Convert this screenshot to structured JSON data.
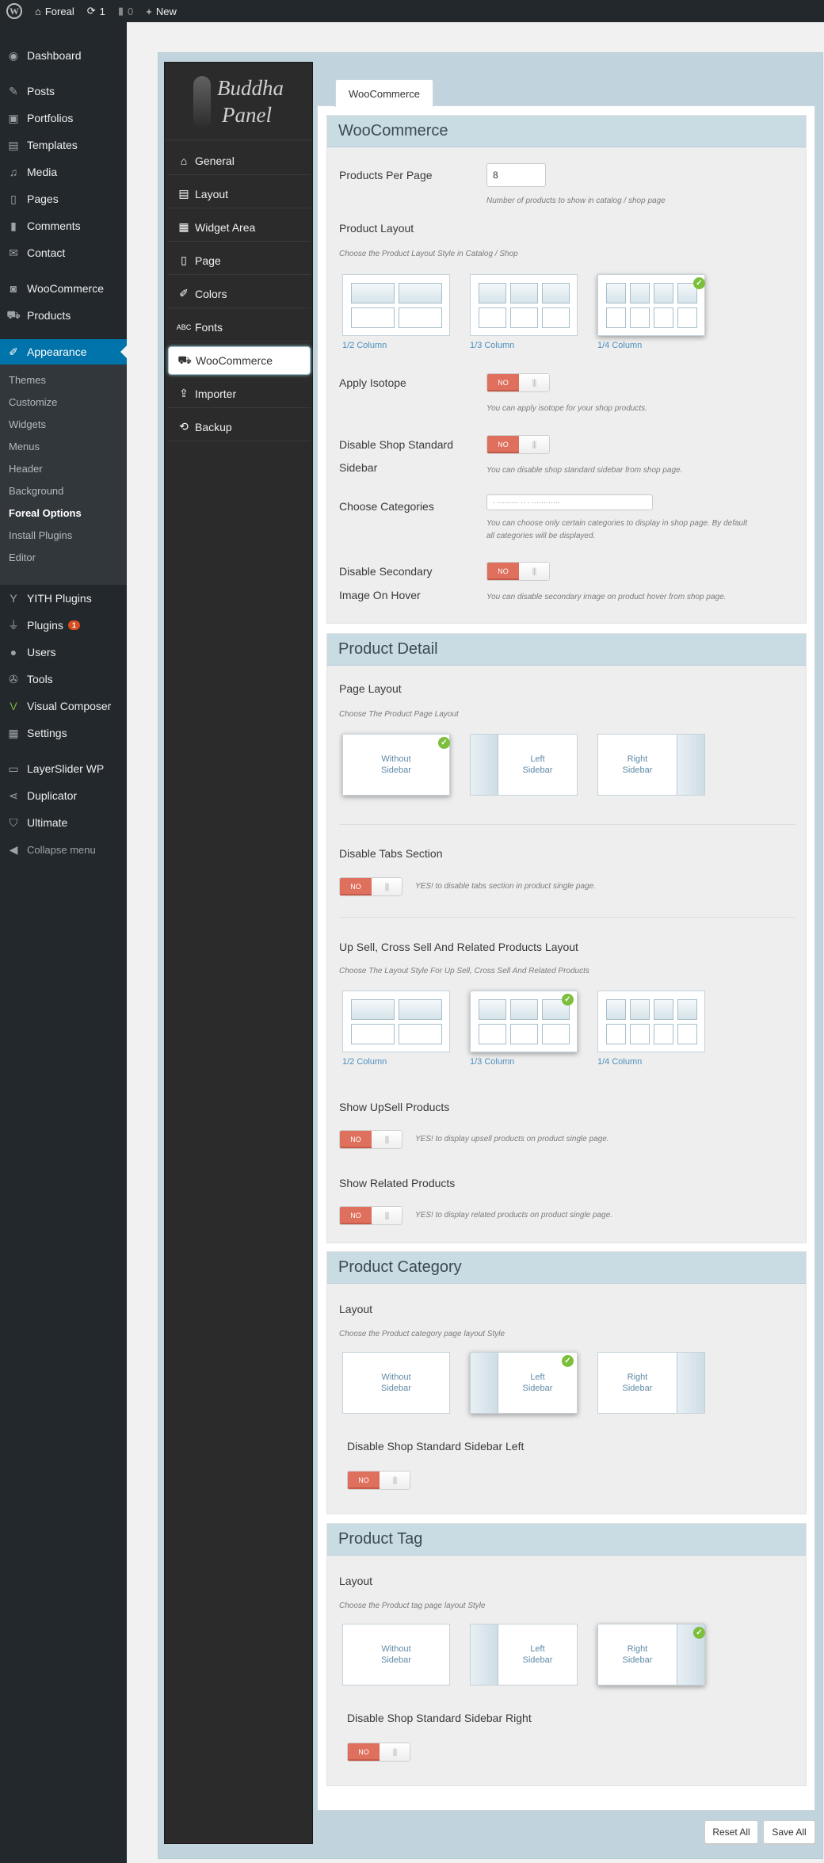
{
  "adminbar": {
    "site": "Foreal",
    "updates": "1",
    "comments": "0",
    "new": "New"
  },
  "menu": {
    "dashboard": "Dashboard",
    "posts": "Posts",
    "portfolios": "Portfolios",
    "templates": "Templates",
    "media": "Media",
    "pages": "Pages",
    "comments": "Comments",
    "contact": "Contact",
    "woocommerce": "WooCommerce",
    "products": "Products",
    "appearance": "Appearance",
    "sub": [
      "Themes",
      "Customize",
      "Widgets",
      "Menus",
      "Header",
      "Background",
      "Foreal Options",
      "Install Plugins",
      "Editor"
    ],
    "yith": "YITH Plugins",
    "plugins": "Plugins",
    "plugins_badge": "1",
    "users": "Users",
    "tools": "Tools",
    "vc": "Visual Composer",
    "settings": "Settings",
    "layerslider": "LayerSlider WP",
    "duplicator": "Duplicator",
    "ultimate": "Ultimate",
    "collapse": "Collapse menu"
  },
  "panel": {
    "logo_line1": "Buddha",
    "logo_line2": "Panel",
    "nav": [
      "General",
      "Layout",
      "Widget Area",
      "Page",
      "Colors",
      "Fonts",
      "WooCommerce",
      "Importer",
      "Backup"
    ],
    "tab": "WooCommerce"
  },
  "woo": {
    "title": "WooCommerce",
    "ppp_label": "Products Per Page",
    "ppp_value": "8",
    "ppp_hint": "Number of products to show in catalog / shop page",
    "layout_label": "Product Layout",
    "layout_hint": "Choose the Product Layout Style in Catalog / Shop",
    "cols": [
      "1/2 Column",
      "1/3 Column",
      "1/4 Column"
    ],
    "isotope_label": "Apply Isotope",
    "isotope_hint": "You can apply isotope for your shop products.",
    "sidebar_label_1": "Disable Shop Standard",
    "sidebar_label_2": "Sidebar",
    "sidebar_hint": "You can disable shop standard sidebar from shop page.",
    "cats_label": "Choose Categories",
    "cats_value": "· ········· ·· ·  ············",
    "cats_hint_1": "You can choose only certain categories to display in shop page. By default",
    "cats_hint_2": "all categories will be displayed.",
    "secondary_label_1": "Disable Secondary",
    "secondary_label_2": "Image On Hover",
    "secondary_hint": "You can disable secondary image on product hover from shop page.",
    "no": "NO"
  },
  "detail": {
    "title": "Product Detail",
    "page_layout_label": "Page Layout",
    "page_layout_hint": "Choose The Product Page Layout",
    "opt_without_1": "Without",
    "opt_without_2": "Sidebar",
    "opt_left_1": "Left",
    "opt_left_2": "Sidebar",
    "opt_right_1": "Right",
    "opt_right_2": "Sidebar",
    "tabs_label": "Disable Tabs Section",
    "tabs_hint": "YES! to disable tabs section in product single page.",
    "upsell_layout_label": "Up Sell, Cross Sell And Related Products Layout",
    "upsell_layout_hint": "Choose The Layout Style For Up Sell, Cross Sell And Related Products",
    "cols": [
      "1/2 Column",
      "1/3 Column",
      "1/4 Column"
    ],
    "show_upsell_label": "Show UpSell Products",
    "show_upsell_hint": "YES! to display upsell products on product single page.",
    "show_related_label": "Show Related Products",
    "show_related_hint": "YES! to display related products on product single page."
  },
  "category": {
    "title": "Product Category",
    "layout_label": "Layout",
    "layout_hint": "Choose the Product category page layout Style",
    "sidebar_left_label": "Disable Shop Standard Sidebar Left"
  },
  "tag": {
    "title": "Product Tag",
    "layout_label": "Layout",
    "layout_hint": "Choose the Product tag page layout Style",
    "sidebar_right_label": "Disable Shop Standard Sidebar Right"
  },
  "footer": {
    "reset": "Reset All",
    "save": "Save All"
  },
  "colors": {
    "accent": "#0073aa",
    "toggle_off": "#e0705e",
    "check": "#7cbf3b",
    "section_header": "#c9dbe3"
  }
}
